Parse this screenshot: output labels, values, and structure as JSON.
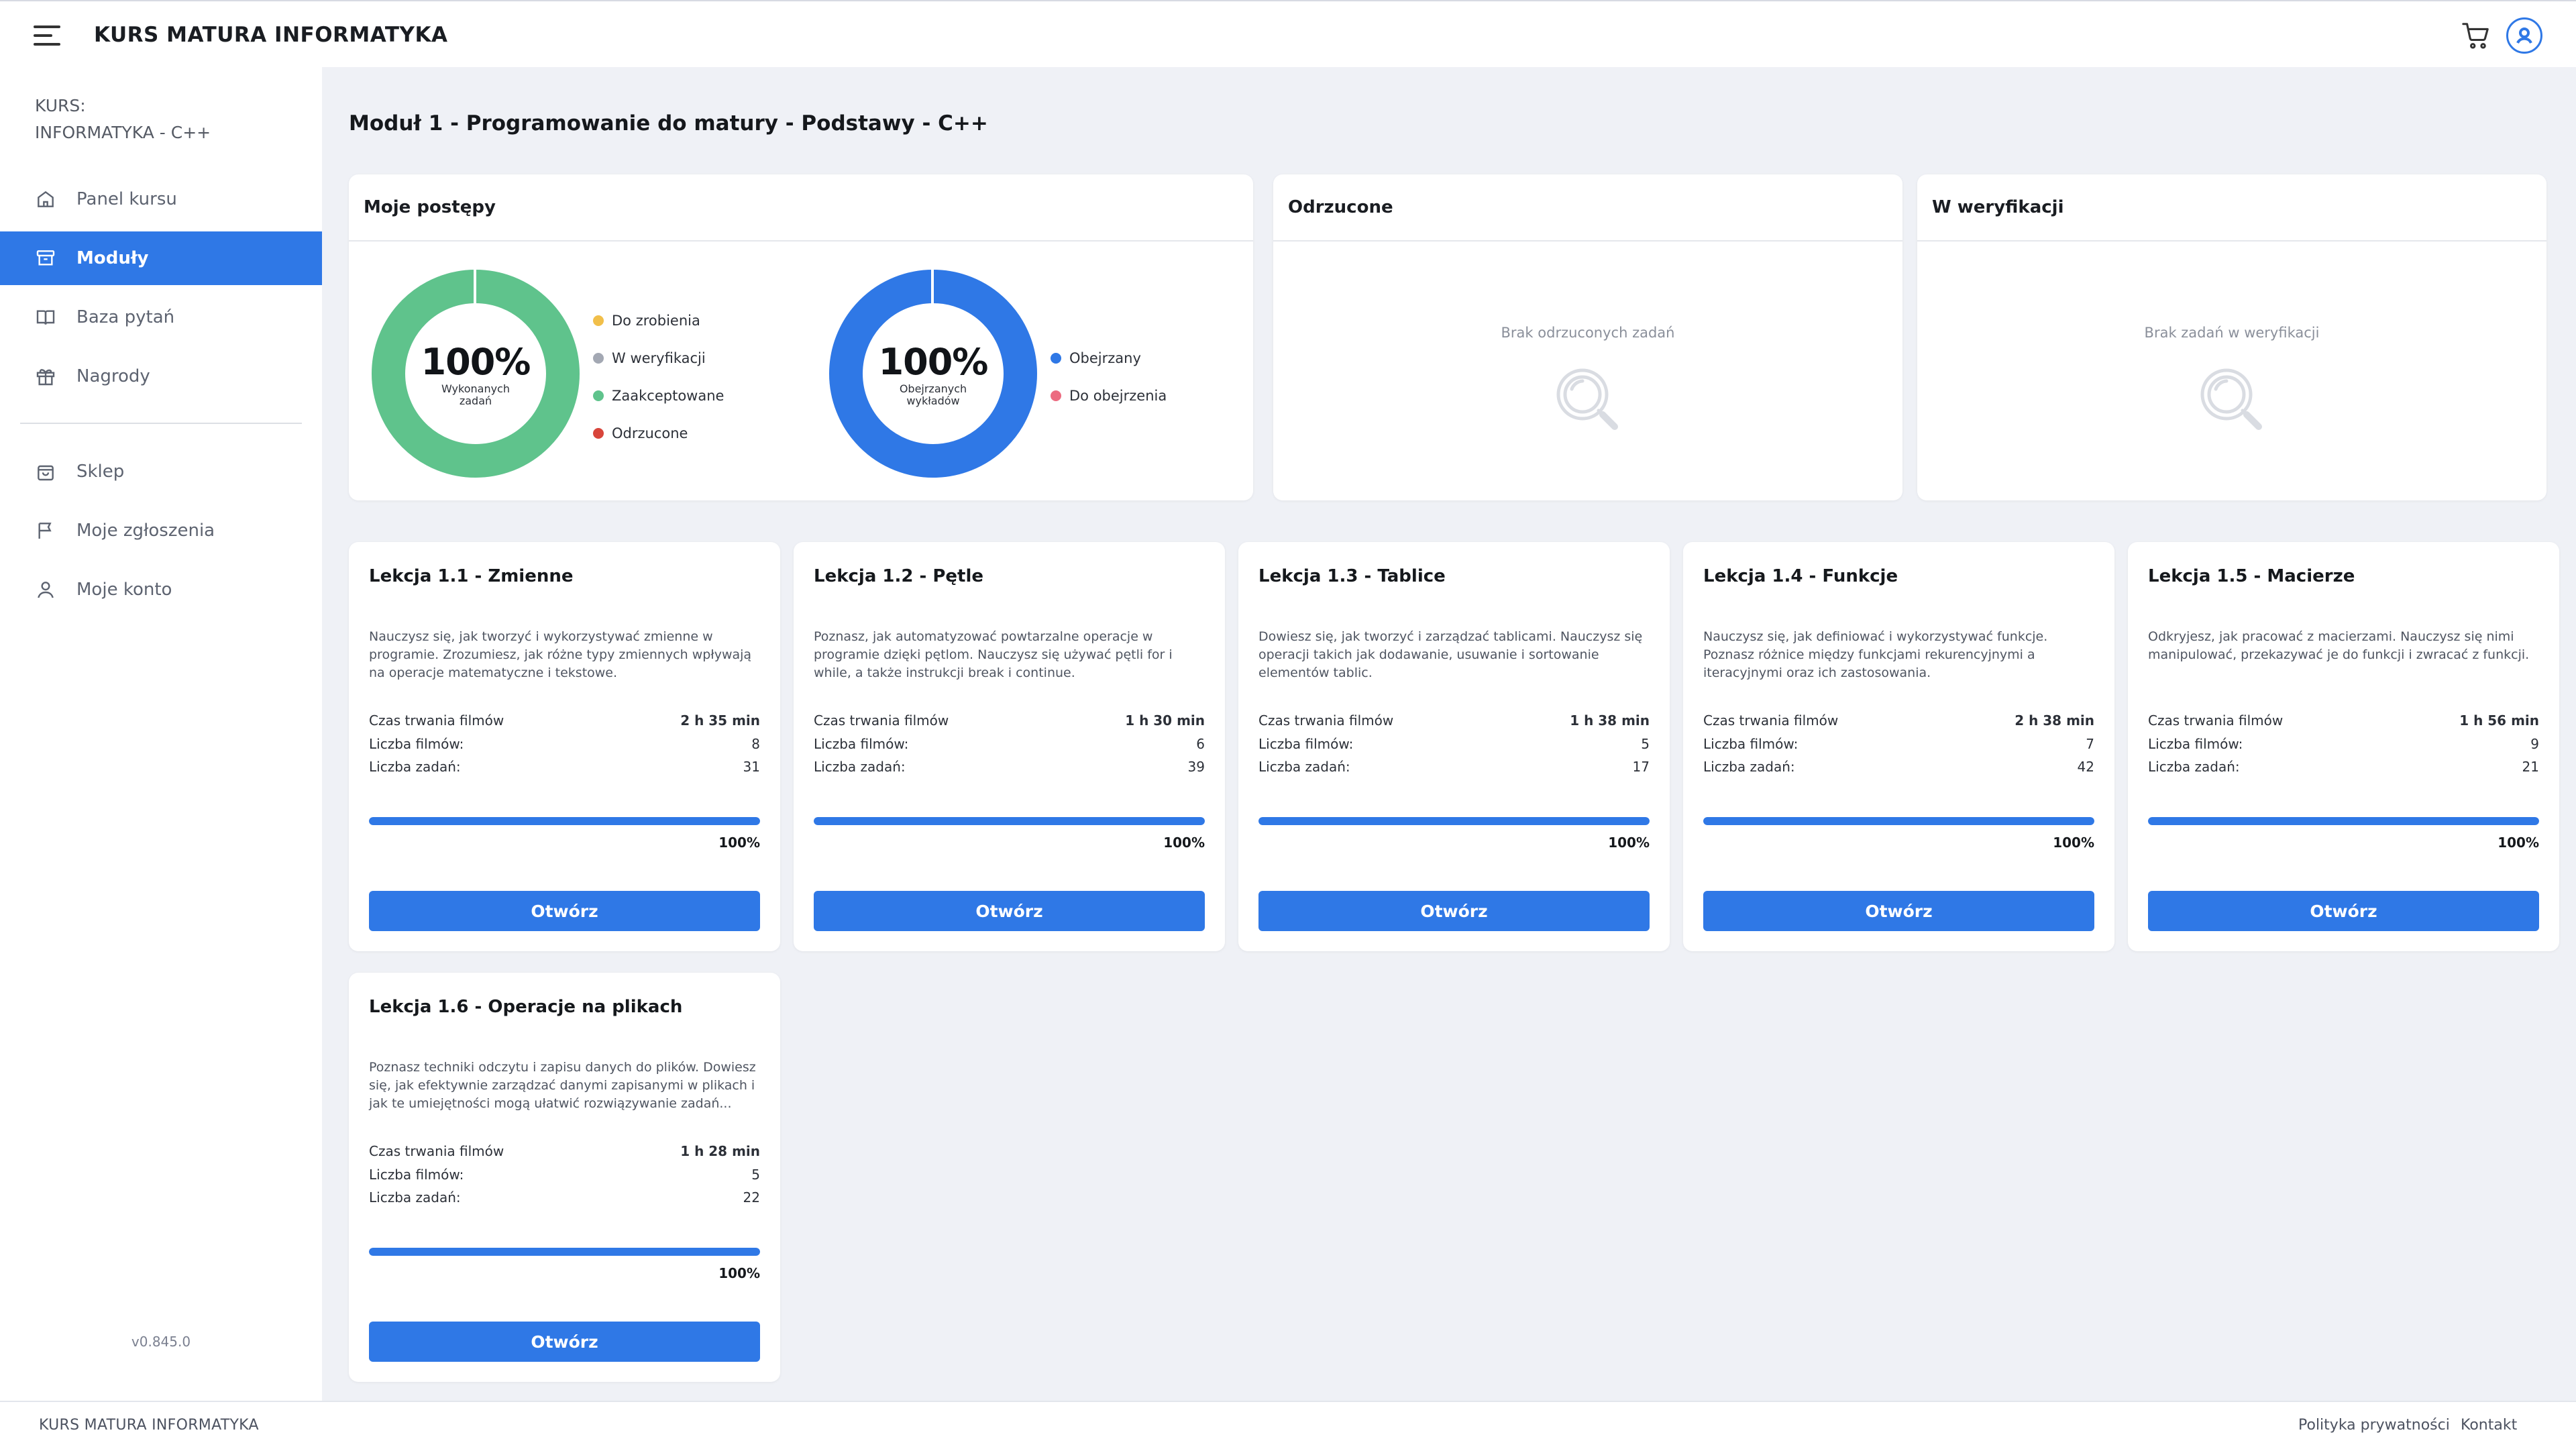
{
  "app": {
    "title": "KURS MATURA INFORMATYKA"
  },
  "sidebar": {
    "course_label_1": "KURS:",
    "course_label_2": "INFORMATYKA - C++",
    "items": [
      {
        "label": "Panel kursu",
        "icon": "home-icon"
      },
      {
        "label": "Moduły",
        "icon": "archive-icon",
        "active": true
      },
      {
        "label": "Baza pytań",
        "icon": "book-icon"
      },
      {
        "label": "Nagrody",
        "icon": "gift-icon"
      },
      {
        "label": "Sklep",
        "icon": "bag-icon"
      },
      {
        "label": "Moje zgłoszenia",
        "icon": "flag-icon"
      },
      {
        "label": "Moje konto",
        "icon": "user-icon"
      }
    ],
    "version": "v0.845.0"
  },
  "page": {
    "title": "Moduł 1 - Programowanie do matury - Podstawy - C++"
  },
  "progress_card": {
    "title": "Moje postępy",
    "tasks_donut": {
      "pct": "100%",
      "sub": "Wykonanych zadań",
      "value": 1.0,
      "color": "#5fc38c"
    },
    "tasks_legend": [
      {
        "label": "Do zrobienia",
        "color": "#f1bf4a"
      },
      {
        "label": "W weryfikacji",
        "color": "#a3a8b3"
      },
      {
        "label": "Zaakceptowane",
        "color": "#5fc38c"
      },
      {
        "label": "Odrzucone",
        "color": "#d8453b"
      }
    ],
    "videos_donut": {
      "pct": "100%",
      "sub": "Obejrzanych wykładów",
      "value": 1.0,
      "color": "#2f78e6"
    },
    "videos_legend": [
      {
        "label": "Obejrzany",
        "color": "#2f78e6"
      },
      {
        "label": "Do obejrzenia",
        "color": "#ec6b80"
      }
    ]
  },
  "rejected_card": {
    "title": "Odrzucone",
    "empty": "Brak odrzuconych zadań"
  },
  "verification_card": {
    "title": "W weryfikacji",
    "empty": "Brak zadań w weryfikacji"
  },
  "lesson_labels": {
    "duration": "Czas trwania filmów",
    "videos": "Liczba filmów:",
    "tasks": "Liczba zadań:",
    "open": "Otwórz"
  },
  "lessons": [
    {
      "title": "Lekcja 1.1 - Zmienne",
      "desc": "Nauczysz się, jak tworzyć i wykorzystywać zmienne w programie. Zrozumiesz, jak różne typy zmiennych wpływają na operacje matematyczne i tekstowe.",
      "duration": "2 h 35 min",
      "videos": "8",
      "tasks": "31",
      "progress_label": "100%",
      "progress": 1.0
    },
    {
      "title": "Lekcja 1.2 - Pętle",
      "desc": "Poznasz, jak automatyzować powtarzalne operacje w programie dzięki pętlom. Nauczysz się używać pętli for i while, a także instrukcji break i continue.",
      "duration": "1 h 30 min",
      "videos": "6",
      "tasks": "39",
      "progress_label": "100%",
      "progress": 1.0
    },
    {
      "title": "Lekcja 1.3 - Tablice",
      "desc": "Dowiesz się, jak tworzyć i zarządzać tablicami. Nauczysz się operacji takich jak dodawanie, usuwanie i sortowanie elementów tablic.",
      "duration": "1 h 38 min",
      "videos": "5",
      "tasks": "17",
      "progress_label": "100%",
      "progress": 1.0
    },
    {
      "title": "Lekcja 1.4 - Funkcje",
      "desc": "Nauczysz się, jak definiować i wykorzystywać funkcje. Poznasz różnice między funkcjami rekurencyjnymi a iteracyjnymi oraz ich zastosowania.",
      "duration": "2 h 38 min",
      "videos": "7",
      "tasks": "42",
      "progress_label": "100%",
      "progress": 1.0
    },
    {
      "title": "Lekcja 1.5 - Macierze",
      "desc": "Odkryjesz, jak pracować z macierzami. Nauczysz się nimi manipulować, przekazywać je do funkcji i zwracać z funkcji.",
      "duration": "1 h 56 min",
      "videos": "9",
      "tasks": "21",
      "progress_label": "100%",
      "progress": 1.0
    },
    {
      "title": "Lekcja 1.6 - Operacje na plikach",
      "desc": "Poznasz techniki odczytu i zapisu danych do plików. Dowiesz się, jak efektywnie zarządzać danymi zapisanymi w plikach i jak te umiejętności mogą ułatwić rozwiązywanie zadań...",
      "duration": "1 h 28 min",
      "videos": "5",
      "tasks": "22",
      "progress_label": "100%",
      "progress": 1.0
    }
  ],
  "footer": {
    "brand": "KURS MATURA INFORMATYKA",
    "privacy": "Polityka prywatności",
    "contact": "Kontakt"
  },
  "colors": {
    "accent": "#2f78e6",
    "success": "#5fc38c"
  }
}
